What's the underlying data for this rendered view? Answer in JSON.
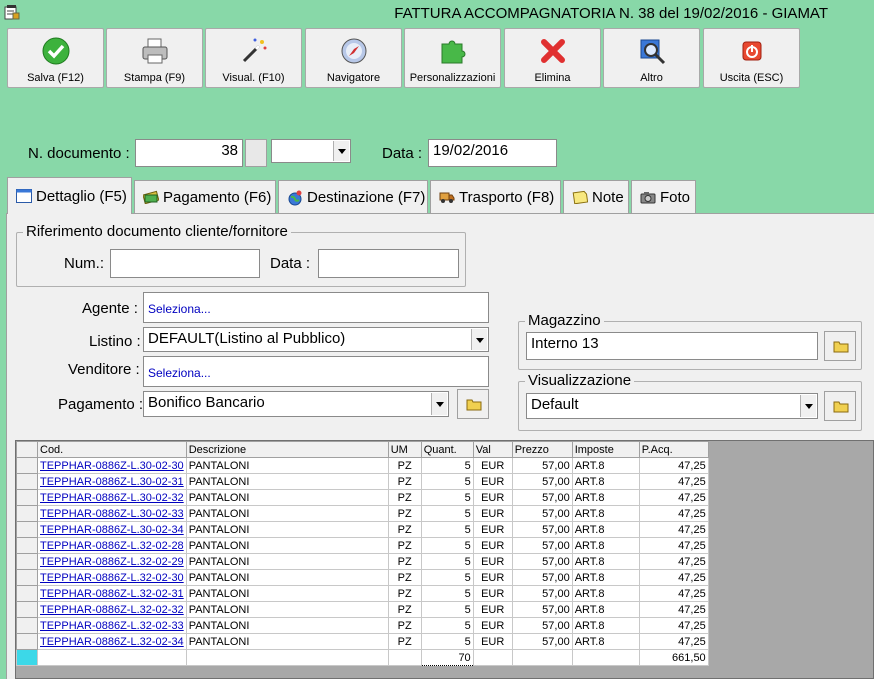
{
  "window": {
    "title": "FATTURA ACCOMPAGNATORIA N. 38 del 19/02/2016 - GIAMAT",
    "icon": "app-icon"
  },
  "toolbar": [
    {
      "label": "Salva (F12)",
      "icon": "save-check-icon"
    },
    {
      "label": "Stampa (F9)",
      "icon": "printer-icon"
    },
    {
      "label": "Visual. (F10)",
      "icon": "magic-wand-icon"
    },
    {
      "label": "Navigatore",
      "icon": "compass-icon"
    },
    {
      "label": "Personalizzazioni",
      "icon": "puzzle-icon"
    },
    {
      "label": "Elimina",
      "icon": "delete-x-icon"
    },
    {
      "label": "Altro",
      "icon": "search-magnifier-icon"
    },
    {
      "label": "Uscita (ESC)",
      "icon": "power-icon"
    }
  ],
  "header": {
    "doc_number_label": "N. documento :",
    "doc_number": "38",
    "date_label": "Data :",
    "date": "19/02/2016"
  },
  "tabs": [
    {
      "label": "Dettaglio (F5)",
      "icon": "detail-icon",
      "active": true
    },
    {
      "label": "Pagamento (F6)",
      "icon": "payment-icon"
    },
    {
      "label": "Destinazione (F7)",
      "icon": "globe-icon"
    },
    {
      "label": "Trasporto (F8)",
      "icon": "truck-icon"
    },
    {
      "label": "Note",
      "icon": "note-icon"
    },
    {
      "label": "Foto",
      "icon": "camera-icon"
    }
  ],
  "reference": {
    "legend": "Riferimento documento cliente/fornitore",
    "num_label": "Num.:",
    "num_value": "",
    "date_label": "Data :",
    "date_value": ""
  },
  "form": {
    "agent_label": "Agente :",
    "agent_value": "Seleziona...",
    "list_label": "Listino :",
    "list_value": "DEFAULT(Listino al Pubblico)",
    "seller_label": "Venditore :",
    "seller_value": "Seleziona...",
    "payment_label": "Pagamento :",
    "payment_value": "Bonifico Bancario"
  },
  "warehouse": {
    "legend": "Magazzino",
    "value": "Interno 13"
  },
  "view": {
    "legend": "Visualizzazione",
    "value": "Default"
  },
  "grid": {
    "columns": [
      "Cod.",
      "Descrizione",
      "UM",
      "Quant.",
      "Val",
      "Prezzo",
      "Imposte",
      "P.Acq."
    ],
    "rows": [
      [
        "TEPPHAR-0886Z-L.30-02-30",
        "PANTALONI",
        "PZ",
        "5",
        "EUR",
        "57,00",
        "ART.8",
        "47,25"
      ],
      [
        "TEPPHAR-0886Z-L.30-02-31",
        "PANTALONI",
        "PZ",
        "5",
        "EUR",
        "57,00",
        "ART.8",
        "47,25"
      ],
      [
        "TEPPHAR-0886Z-L.30-02-32",
        "PANTALONI",
        "PZ",
        "5",
        "EUR",
        "57,00",
        "ART.8",
        "47,25"
      ],
      [
        "TEPPHAR-0886Z-L.30-02-33",
        "PANTALONI",
        "PZ",
        "5",
        "EUR",
        "57,00",
        "ART.8",
        "47,25"
      ],
      [
        "TEPPHAR-0886Z-L.30-02-34",
        "PANTALONI",
        "PZ",
        "5",
        "EUR",
        "57,00",
        "ART.8",
        "47,25"
      ],
      [
        "TEPPHAR-0886Z-L.32-02-28",
        "PANTALONI",
        "PZ",
        "5",
        "EUR",
        "57,00",
        "ART.8",
        "47,25"
      ],
      [
        "TEPPHAR-0886Z-L.32-02-29",
        "PANTALONI",
        "PZ",
        "5",
        "EUR",
        "57,00",
        "ART.8",
        "47,25"
      ],
      [
        "TEPPHAR-0886Z-L.32-02-30",
        "PANTALONI",
        "PZ",
        "5",
        "EUR",
        "57,00",
        "ART.8",
        "47,25"
      ],
      [
        "TEPPHAR-0886Z-L.32-02-31",
        "PANTALONI",
        "PZ",
        "5",
        "EUR",
        "57,00",
        "ART.8",
        "47,25"
      ],
      [
        "TEPPHAR-0886Z-L.32-02-32",
        "PANTALONI",
        "PZ",
        "5",
        "EUR",
        "57,00",
        "ART.8",
        "47,25"
      ],
      [
        "TEPPHAR-0886Z-L.32-02-33",
        "PANTALONI",
        "PZ",
        "5",
        "EUR",
        "57,00",
        "ART.8",
        "47,25"
      ],
      [
        "TEPPHAR-0886Z-L.32-02-34",
        "PANTALONI",
        "PZ",
        "5",
        "EUR",
        "57,00",
        "ART.8",
        "47,25"
      ]
    ],
    "total_quantity": "70",
    "total_purchase": "661,50"
  },
  "colors": {
    "background": "#88d8a8",
    "link": "#0000c0",
    "selection": "#3cd8e8"
  }
}
